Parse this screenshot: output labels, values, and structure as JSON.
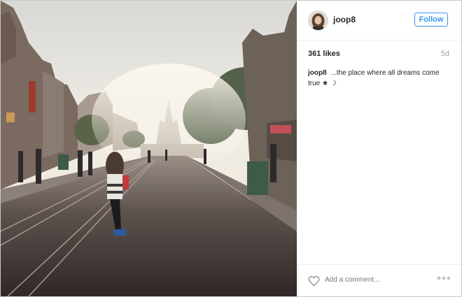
{
  "post": {
    "username": "joop8",
    "follow_label": "Follow",
    "likes": "361 likes",
    "age": "5d",
    "caption_user": "joop8",
    "caption_text": " ...the place where all dreams come true ★ ☽",
    "comment_placeholder": "Add a comment..."
  },
  "icons": {
    "like": "heart-outline-icon",
    "more": "more-options-icon"
  },
  "colors": {
    "accent": "#3897f0",
    "text": "#262626",
    "muted": "#a8a8a8"
  }
}
